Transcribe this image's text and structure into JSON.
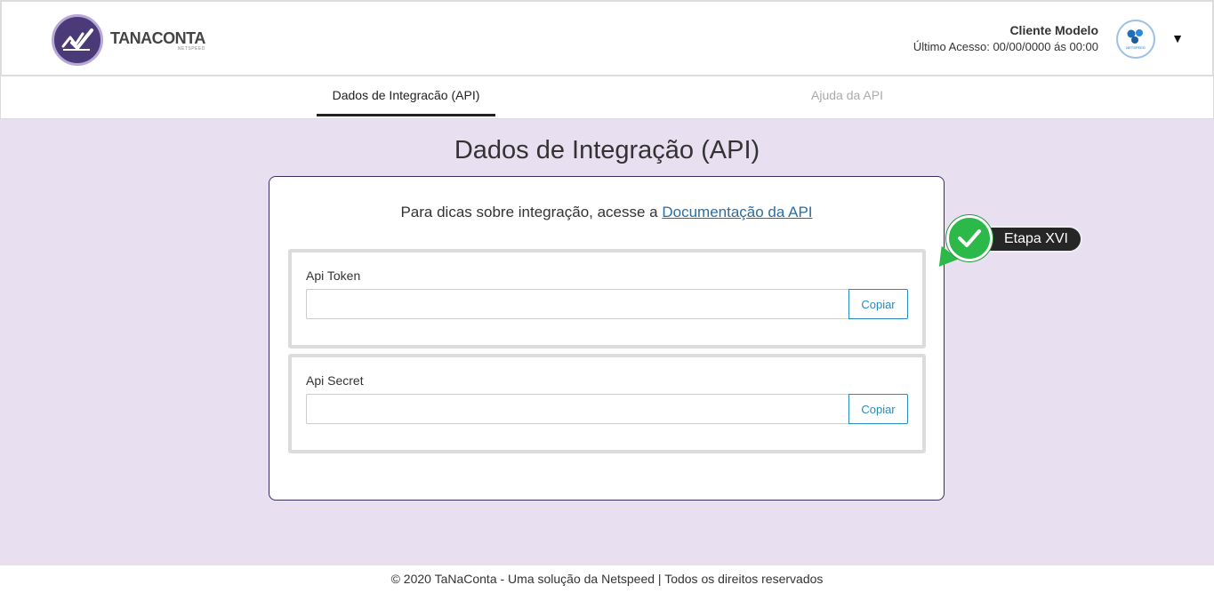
{
  "header": {
    "logo_name": "TANACONTA",
    "logo_sub": "NETSPEED",
    "user_name": "Cliente Modelo",
    "last_access": "Último Acesso: 00/00/0000 ás 00:00",
    "avatar_label": "NETSPEED"
  },
  "tabs": [
    {
      "label": "Dados de Integracão (API)",
      "active": true
    },
    {
      "label": "Ajuda da API",
      "active": false
    }
  ],
  "main": {
    "title": "Dados de Integração (API)",
    "intro_text": "Para dicas sobre integração, acesse a ",
    "intro_link": "Documentação da API",
    "fields": [
      {
        "label": "Api Token",
        "value": "",
        "button": "Copiar"
      },
      {
        "label": "Api Secret",
        "value": "",
        "button": "Copiar"
      }
    ]
  },
  "step_badge": {
    "label": "Etapa XVI",
    "color": "#2db84a"
  },
  "footer": {
    "text": "© 2020 TaNaConta - Uma solução da Netspeed | Todos os direitos reservados"
  },
  "colors": {
    "background": "#e8dff0",
    "accent": "#2a8bbd",
    "logo": "#4a3a78"
  }
}
